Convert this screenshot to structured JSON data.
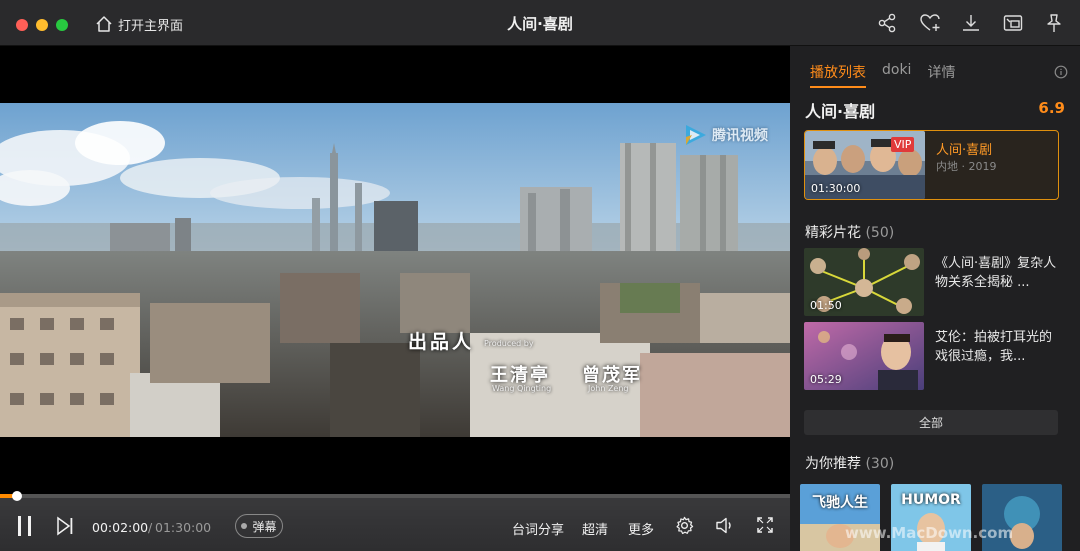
{
  "titlebar": {
    "home_label": "打开主界面",
    "title": "人间·喜剧",
    "icons": [
      "share-icon",
      "heart-plus-icon",
      "download-icon",
      "mini-window-icon",
      "pin-icon"
    ]
  },
  "video": {
    "logo_text": "腾讯视频",
    "credits": {
      "produced_cn": "出品人",
      "produced_en": "Produced by",
      "name1_cn": "王清亭",
      "name1_en": "Wang Qingting",
      "name2_cn": "曾茂军",
      "name2_en": "John Zeng"
    }
  },
  "controls": {
    "progress_fraction": 0.022,
    "current_time": "00:02:00",
    "separator": "/",
    "total_time": "01:30:00",
    "danmu_label": "弹幕",
    "subtitle_share": "台词分享",
    "quality": "超清",
    "more": "更多"
  },
  "sidebar": {
    "tabs": [
      {
        "label": "播放列表",
        "active": true
      },
      {
        "label": "doki",
        "active": false
      },
      {
        "label": "详情",
        "active": false
      }
    ],
    "show_title": "人间·喜剧",
    "score": "6.9",
    "episode": {
      "badge": "VIP",
      "duration": "01:30:00",
      "title": "人间·喜剧",
      "meta": "内地 · 2019"
    },
    "clips_section": {
      "title": "精彩片花",
      "count": "(50)"
    },
    "clips": [
      {
        "duration": "01:50",
        "title": "《人间·喜剧》复杂人物关系全揭秘 ..."
      },
      {
        "duration": "05:29",
        "title": "艾伦：拍被打耳光的戏很过瘾，我..."
      }
    ],
    "all_button": "全部",
    "rec_section": {
      "title": "为你推荐",
      "count": "(30)"
    },
    "recommendations": [
      {
        "label": "飞驰人生"
      },
      {
        "label": "HUMOR"
      },
      {
        "label": ""
      }
    ]
  },
  "watermark": "www.MacDown.com",
  "colors": {
    "accent": "#ff8c1a",
    "progress": "#ff8a00",
    "vip": "#e03a3a"
  }
}
